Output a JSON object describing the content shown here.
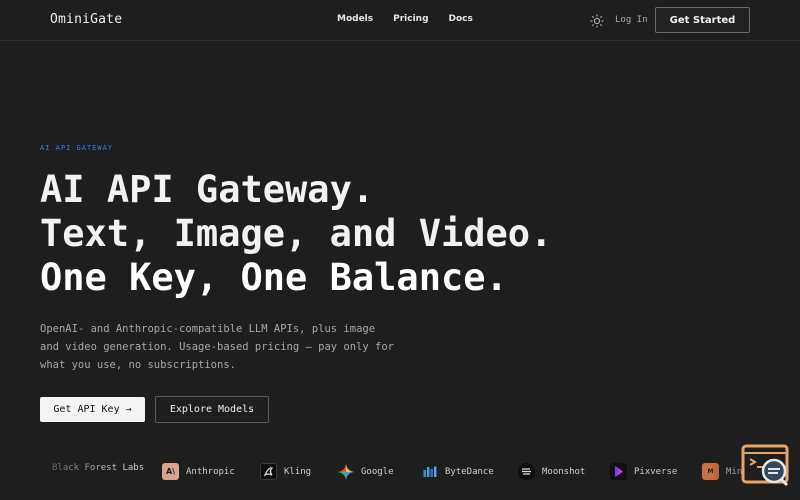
{
  "nav": {
    "brand": "OminiGate",
    "links": [
      "Models",
      "Pricing",
      "Docs"
    ],
    "login": "Log In",
    "get_started": "Get Started"
  },
  "hero": {
    "eyebrow": "AI API GATEWAY",
    "headline": [
      "AI API Gateway.",
      "Text, Image, and Video.",
      "One Key, One Balance."
    ],
    "description": "OpenAI- and Anthropic-compatible LLM APIs, plus image and video generation. Usage-based pricing — pay only for what you use, no subscriptions.",
    "primary_cta": "Get API Key →",
    "secondary_cta": "Explore Models"
  },
  "providers": [
    {
      "name": "Black Forest Labs",
      "icon": "none"
    },
    {
      "name": "Anthropic",
      "icon": "anthropic-icon"
    },
    {
      "name": "Kling",
      "icon": "kling-icon"
    },
    {
      "name": "Google",
      "icon": "google-gemini-icon"
    },
    {
      "name": "ByteDance",
      "icon": "bytedance-icon"
    },
    {
      "name": "Moonshot",
      "icon": "moonshot-icon"
    },
    {
      "name": "Pixverse",
      "icon": "pixverse-icon"
    },
    {
      "name": "Mini",
      "icon": "minimax-icon"
    }
  ],
  "colors": {
    "background": "#1e1e1e",
    "accent": "#3f7fe0",
    "anthropic": "#d8a58a",
    "widget": "#e8a36a"
  }
}
